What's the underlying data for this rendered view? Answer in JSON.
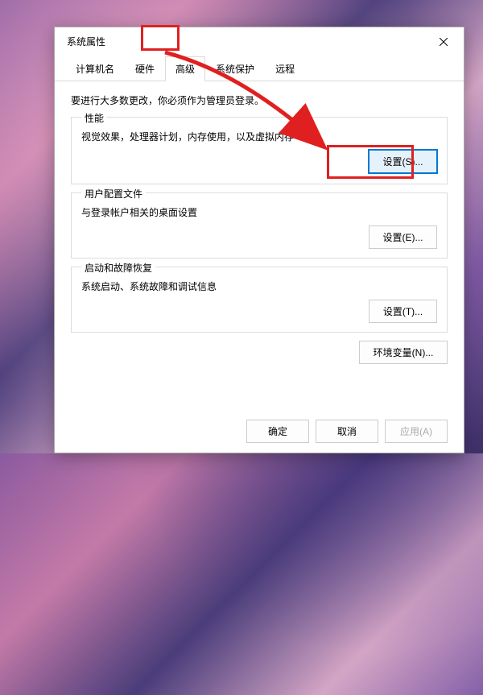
{
  "window": {
    "title": "系统属性"
  },
  "tabs": {
    "items": [
      {
        "label": "计算机名"
      },
      {
        "label": "硬件"
      },
      {
        "label": "高级"
      },
      {
        "label": "系统保护"
      },
      {
        "label": "远程"
      }
    ],
    "active_index": 2
  },
  "content": {
    "intro": "要进行大多数更改，你必须作为管理员登录。",
    "performance": {
      "legend": "性能",
      "desc": "视觉效果，处理器计划，内存使用，以及虚拟内存",
      "button": "设置(S)..."
    },
    "user_profile": {
      "legend": "用户配置文件",
      "desc": "与登录帐户相关的桌面设置",
      "button": "设置(E)..."
    },
    "startup": {
      "legend": "启动和故障恢复",
      "desc": "系统启动、系统故障和调试信息",
      "button": "设置(T)..."
    },
    "env_button": "环境变量(N)..."
  },
  "footer": {
    "ok": "确定",
    "cancel": "取消",
    "apply": "应用(A)"
  }
}
